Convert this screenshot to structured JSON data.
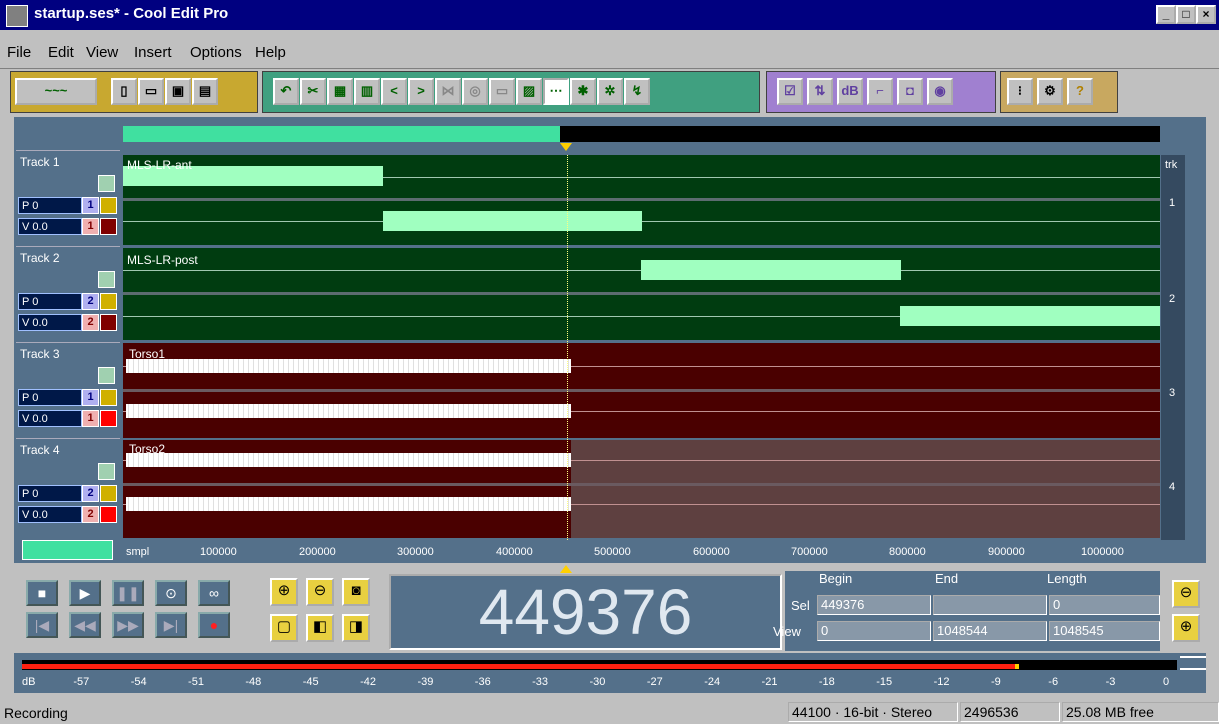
{
  "window": {
    "title": "startup.ses* - Cool Edit Pro"
  },
  "menu": {
    "items": [
      "File",
      "Edit",
      "View",
      "Insert",
      "Options",
      "Help"
    ]
  },
  "tracks": [
    {
      "name": "Track 1",
      "pan": "P 0",
      "vol": "V 0.0",
      "out": "1",
      "rec": "1",
      "clip": "MLS-LR-ant",
      "trk": "1"
    },
    {
      "name": "Track 2",
      "pan": "P 0",
      "vol": "V 0.0",
      "out": "2",
      "rec": "2",
      "clip": "MLS-LR-post",
      "trk": "2"
    },
    {
      "name": "Track 3",
      "pan": "P 0",
      "vol": "V 0.0",
      "out": "1",
      "rec": "1",
      "clip": "Torso1",
      "trk": "3"
    },
    {
      "name": "Track 4",
      "pan": "P 0",
      "vol": "V 0.0",
      "out": "2",
      "rec": "2",
      "clip": "Torso2",
      "trk": "4"
    }
  ],
  "trk_header": "trk",
  "ruler": {
    "unit": "smpl",
    "ticks": [
      "100000",
      "200000",
      "300000",
      "400000",
      "500000",
      "600000",
      "700000",
      "800000",
      "900000",
      "1000000"
    ]
  },
  "time": {
    "display": "449376"
  },
  "selection": {
    "headers": {
      "begin": "Begin",
      "end": "End",
      "length": "Length"
    },
    "sel_label": "Sel",
    "view_label": "View",
    "sel": {
      "begin": "449376",
      "end": "",
      "length": "0"
    },
    "view": {
      "begin": "0",
      "end": "1048544",
      "length": "1048545"
    }
  },
  "meter": {
    "scale": [
      "dB",
      "-57",
      "-54",
      "-51",
      "-48",
      "-45",
      "-42",
      "-39",
      "-36",
      "-33",
      "-30",
      "-27",
      "-24",
      "-21",
      "-18",
      "-15",
      "-12",
      "-9",
      "-6",
      "-3",
      "0"
    ],
    "level_fraction": 0.86
  },
  "status": {
    "mode": "Recording",
    "format": "44100 · 16-bit · Stereo",
    "samples": "2496536",
    "free": "25.08 MB free"
  },
  "colors": {
    "titlebar": "#000080",
    "track_green": "#003c10",
    "track_red": "#4a0000",
    "clip": "#a0ffc0",
    "session": "#54708a"
  }
}
